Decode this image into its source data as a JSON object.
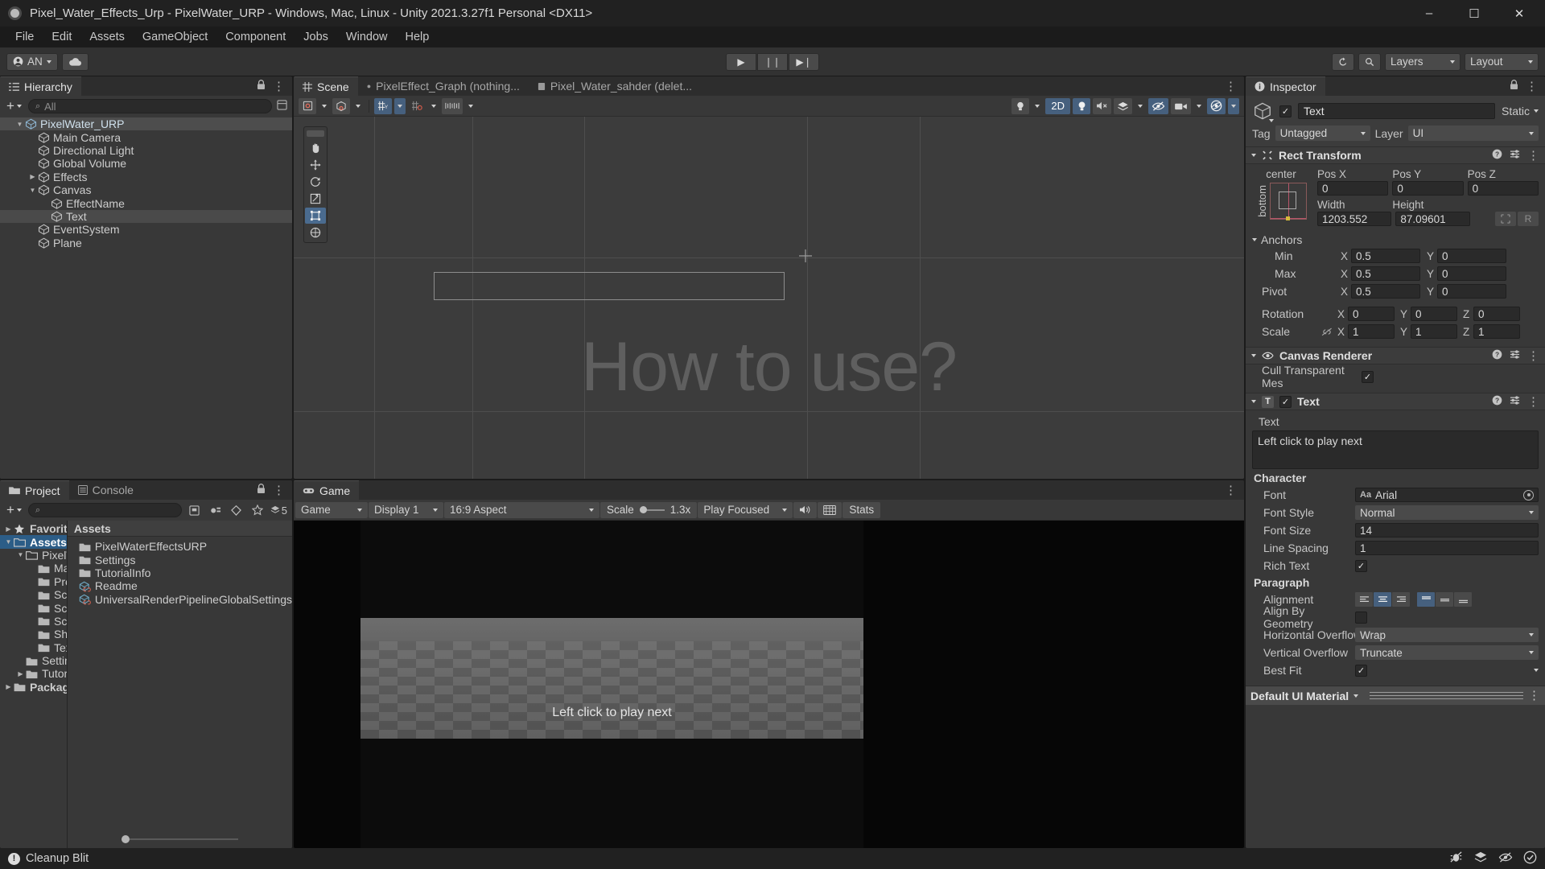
{
  "window": {
    "title": "Pixel_Water_Effects_Urp - PixelWater_URP - Windows, Mac, Linux - Unity 2021.3.27f1 Personal <DX11>",
    "minimize": "–",
    "maximize": "☐",
    "close": "✕"
  },
  "menubar": {
    "items": [
      "File",
      "Edit",
      "Assets",
      "GameObject",
      "Component",
      "Jobs",
      "Window",
      "Help"
    ]
  },
  "toolbar": {
    "account_label": "AN",
    "cloud_icon": "cloud-icon",
    "play": "▶",
    "pause": "❘❘",
    "step": "▶❘",
    "history_icon": "undo-history-icon",
    "search_icon": "search-icon",
    "layers_label": "Layers",
    "layout_label": "Layout"
  },
  "hierarchy": {
    "tab_label": "Hierarchy",
    "search_placeholder": "All",
    "plus_label": "+",
    "items": [
      {
        "label": "PixelWater_URP",
        "depth": 0,
        "twisty": "down",
        "selected": true,
        "icon": "prefab-icon"
      },
      {
        "label": "Main Camera",
        "depth": 1,
        "twisty": "",
        "selected": false,
        "icon": "gameobject-icon"
      },
      {
        "label": "Directional Light",
        "depth": 1,
        "twisty": "",
        "selected": false,
        "icon": "gameobject-icon"
      },
      {
        "label": "Global Volume",
        "depth": 1,
        "twisty": "",
        "selected": false,
        "icon": "gameobject-icon"
      },
      {
        "label": "Effects",
        "depth": 1,
        "twisty": "right",
        "selected": false,
        "icon": "gameobject-icon"
      },
      {
        "label": "Canvas",
        "depth": 1,
        "twisty": "down",
        "selected": false,
        "icon": "gameobject-icon"
      },
      {
        "label": "EffectName",
        "depth": 2,
        "twisty": "",
        "selected": false,
        "icon": "gameobject-icon"
      },
      {
        "label": "Text",
        "depth": 2,
        "twisty": "",
        "selected": true,
        "icon": "gameobject-icon"
      },
      {
        "label": "EventSystem",
        "depth": 1,
        "twisty": "",
        "selected": false,
        "icon": "gameobject-icon"
      },
      {
        "label": "Plane",
        "depth": 1,
        "twisty": "",
        "selected": false,
        "icon": "gameobject-icon"
      }
    ]
  },
  "scene": {
    "tabs": [
      {
        "label": "Scene",
        "active": true,
        "icon": "grid-icon"
      },
      {
        "label": "PixelEffect_Graph (nothing...",
        "active": false,
        "icon": "dot-icon"
      },
      {
        "label": "Pixel_Water_sahder (delet...",
        "active": false,
        "icon": "shader-icon"
      }
    ],
    "tools": [
      "hand-tool",
      "move-tool",
      "rotate-tool",
      "scale-tool",
      "rect-tool",
      "transform-tool"
    ],
    "mode_2d": "2D",
    "toolbar_icons": [
      "pivot-icon",
      "local-global-icon",
      "grid-snap-icon",
      "grid-visibility-icon",
      "snap-increment-icon",
      "audio-icon",
      "fx-icon",
      "scene-visibility-icon",
      "camera-icon",
      "gizmos-icon"
    ],
    "canvas_text": "How to use?"
  },
  "project": {
    "tabs": [
      {
        "label": "Project",
        "active": true,
        "icon": "folder-icon"
      },
      {
        "label": "Console",
        "active": false,
        "icon": "console-icon"
      }
    ],
    "search_placeholder": "",
    "count_badge": "5",
    "breadcrumb": "Assets",
    "tree": [
      {
        "label": "Favorites",
        "depth": 0,
        "twisty": "right",
        "icon": "star-icon",
        "selected": false,
        "bold": true
      },
      {
        "label": "Assets",
        "depth": 0,
        "twisty": "down",
        "icon": "folder-open-icon",
        "selected": true,
        "bold": true
      },
      {
        "label": "PixelWaterEffectsURP",
        "depth": 1,
        "twisty": "down",
        "icon": "folder-open-icon",
        "selected": false,
        "bold": false
      },
      {
        "label": "Materials",
        "depth": 2,
        "twisty": "",
        "icon": "folder-icon",
        "selected": false,
        "bold": false
      },
      {
        "label": "Prefabs",
        "depth": 2,
        "twisty": "",
        "icon": "folder-icon",
        "selected": false,
        "bold": false
      },
      {
        "label": "SceneMaterials",
        "depth": 2,
        "twisty": "",
        "icon": "folder-icon",
        "selected": false,
        "bold": false
      },
      {
        "label": "Scenes",
        "depth": 2,
        "twisty": "",
        "icon": "folder-icon",
        "selected": false,
        "bold": false
      },
      {
        "label": "Scripts",
        "depth": 2,
        "twisty": "",
        "icon": "folder-icon",
        "selected": false,
        "bold": false
      },
      {
        "label": "Shaders",
        "depth": 2,
        "twisty": "",
        "icon": "folder-icon",
        "selected": false,
        "bold": false
      },
      {
        "label": "Textures",
        "depth": 2,
        "twisty": "",
        "icon": "folder-icon",
        "selected": false,
        "bold": false
      },
      {
        "label": "Settings",
        "depth": 1,
        "twisty": "",
        "icon": "folder-icon",
        "selected": false,
        "bold": false
      },
      {
        "label": "TutorialInfo",
        "depth": 1,
        "twisty": "right",
        "icon": "folder-icon",
        "selected": false,
        "bold": false
      },
      {
        "label": "Packages",
        "depth": 0,
        "twisty": "right",
        "icon": "folder-icon",
        "selected": false,
        "bold": true
      }
    ],
    "items": [
      {
        "label": "PixelWaterEffectsURP",
        "icon": "folder-icon"
      },
      {
        "label": "Settings",
        "icon": "folder-icon"
      },
      {
        "label": "TutorialInfo",
        "icon": "folder-icon"
      },
      {
        "label": "Readme",
        "icon": "scriptableobject-icon"
      },
      {
        "label": "UniversalRenderPipelineGlobalSettings",
        "icon": "scriptableobject-icon"
      }
    ]
  },
  "game": {
    "tab_label": "Game",
    "mode": "Game",
    "display": "Display 1",
    "aspect": "16:9 Aspect",
    "scale_label": "Scale",
    "scale_value": "1.3x",
    "play_mode": "Play Focused",
    "mute_icon": "speaker-icon",
    "gizmo_icon": "keyboard-icon",
    "stats_label": "Stats",
    "overlay_text": "Left click to play next"
  },
  "inspector": {
    "tab_label": "Inspector",
    "object_name": "Text",
    "enabled": true,
    "static_label": "Static",
    "tag_label": "Tag",
    "tag_value": "Untagged",
    "layer_label": "Layer",
    "layer_value": "UI",
    "rect_transform": {
      "title": "Rect Transform",
      "anchor_preset_top": "center",
      "anchor_preset_side": "bottom",
      "pos_labels": [
        "Pos X",
        "Pos Y",
        "Pos Z"
      ],
      "pos_values": [
        "0",
        "0",
        "0"
      ],
      "size_labels": [
        "Width",
        "Height"
      ],
      "size_values": [
        "1203.552",
        "87.09601"
      ],
      "blueprint_btn": "blueprint-mode-icon",
      "raw_btn": "R",
      "anchors_label": "Anchors",
      "min_label": "Min",
      "min_x": "0.5",
      "min_y": "0",
      "max_label": "Max",
      "max_x": "0.5",
      "max_y": "0",
      "pivot_label": "Pivot",
      "pivot_x": "0.5",
      "pivot_y": "0",
      "rotation_label": "Rotation",
      "rotation": [
        "0",
        "0",
        "0"
      ],
      "scale_label": "Scale",
      "scale": [
        "1",
        "1",
        "1"
      ]
    },
    "canvas_renderer": {
      "title": "Canvas Renderer",
      "cull_label": "Cull Transparent Mes",
      "cull_checked": true
    },
    "text_component": {
      "title": "Text",
      "enabled": true,
      "text_label": "Text",
      "text_value": "Left click to play next",
      "character_label": "Character",
      "font_label": "Font",
      "font_value": "Arial",
      "font_style_label": "Font Style",
      "font_style_value": "Normal",
      "font_size_label": "Font Size",
      "font_size_value": "14",
      "line_spacing_label": "Line Spacing",
      "line_spacing_value": "1",
      "rich_text_label": "Rich Text",
      "rich_text_checked": true,
      "paragraph_label": "Paragraph",
      "alignment_label": "Alignment",
      "align_h_selected": 1,
      "align_v_selected": 0,
      "align_geometry_label": "Align By Geometry",
      "align_geometry_checked": false,
      "h_overflow_label": "Horizontal Overflow",
      "h_overflow_value": "Wrap",
      "v_overflow_label": "Vertical Overflow",
      "v_overflow_value": "Truncate",
      "best_fit_label": "Best Fit",
      "best_fit_checked": true
    },
    "material": {
      "name": "Default UI Material"
    }
  },
  "statusbar": {
    "message": "Cleanup Blit",
    "icons": [
      "bug-icon",
      "layers-status-icon",
      "eye-off-icon",
      "check-circle-icon"
    ]
  },
  "colors": {
    "accent_blue": "#2c5d87",
    "tool_active": "#46607e",
    "panel_bg": "#383838",
    "toolbar_bg": "#323232",
    "chrome_bg": "#212121"
  }
}
